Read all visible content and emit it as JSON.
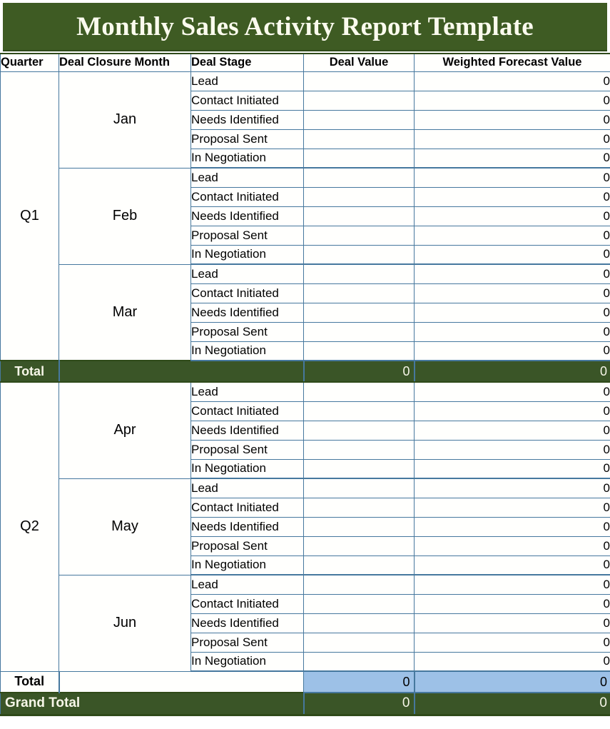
{
  "title": "Monthly Sales Activity Report Template",
  "colors": {
    "banner_green": "#3E5B23",
    "total_green": "#3A5527",
    "selection_blue": "#9DC1E7",
    "grid_border": "#46789E",
    "cell_background": "#FFFFFD",
    "banner_text": "#FBFBEE"
  },
  "columns": [
    {
      "key": "quarter",
      "label": "Quarter"
    },
    {
      "key": "month",
      "label": "Deal Closure Month"
    },
    {
      "key": "stage",
      "label": "Deal Stage"
    },
    {
      "key": "value",
      "label": "Deal Value"
    },
    {
      "key": "wfv",
      "label": "Weighted Forecast Value"
    }
  ],
  "stages": [
    "Lead",
    "Contact Initiated",
    "Needs Identified",
    "Proposal Sent",
    "In Negotiation"
  ],
  "quarters": [
    {
      "label": "Q1",
      "months": [
        {
          "name": "Jan",
          "rows": [
            {
              "stage": "Lead",
              "value": "",
              "wfv": "0"
            },
            {
              "stage": "Contact Initiated",
              "value": "",
              "wfv": "0"
            },
            {
              "stage": "Needs Identified",
              "value": "",
              "wfv": "0"
            },
            {
              "stage": "Proposal Sent",
              "value": "",
              "wfv": "0"
            },
            {
              "stage": "In Negotiation",
              "value": "",
              "wfv": "0"
            }
          ]
        },
        {
          "name": "Feb",
          "rows": [
            {
              "stage": "Lead",
              "value": "",
              "wfv": "0"
            },
            {
              "stage": "Contact Initiated",
              "value": "",
              "wfv": "0"
            },
            {
              "stage": "Needs Identified",
              "value": "",
              "wfv": "0"
            },
            {
              "stage": "Proposal Sent",
              "value": "",
              "wfv": "0"
            },
            {
              "stage": "In Negotiation",
              "value": "",
              "wfv": "0"
            }
          ]
        },
        {
          "name": "Mar",
          "rows": [
            {
              "stage": "Lead",
              "value": "",
              "wfv": "0"
            },
            {
              "stage": "Contact Initiated",
              "value": "",
              "wfv": "0"
            },
            {
              "stage": "Needs Identified",
              "value": "",
              "wfv": "0"
            },
            {
              "stage": "Proposal Sent",
              "value": "",
              "wfv": "0"
            },
            {
              "stage": "In Negotiation",
              "value": "",
              "wfv": "0"
            }
          ]
        }
      ],
      "total": {
        "label": "Total",
        "value": "0",
        "wfv": "0",
        "style": "green"
      }
    },
    {
      "label": "Q2",
      "months": [
        {
          "name": "Apr",
          "rows": [
            {
              "stage": "Lead",
              "value": "",
              "wfv": "0"
            },
            {
              "stage": "Contact Initiated",
              "value": "",
              "wfv": "0"
            },
            {
              "stage": "Needs Identified",
              "value": "",
              "wfv": "0"
            },
            {
              "stage": "Proposal Sent",
              "value": "",
              "wfv": "0"
            },
            {
              "stage": "In Negotiation",
              "value": "",
              "wfv": "0"
            }
          ]
        },
        {
          "name": "May",
          "rows": [
            {
              "stage": "Lead",
              "value": "",
              "wfv": "0"
            },
            {
              "stage": "Contact Initiated",
              "value": "",
              "wfv": "0"
            },
            {
              "stage": "Needs Identified",
              "value": "",
              "wfv": "0"
            },
            {
              "stage": "Proposal Sent",
              "value": "",
              "wfv": "0"
            },
            {
              "stage": "In Negotiation",
              "value": "",
              "wfv": "0"
            }
          ]
        },
        {
          "name": "Jun",
          "rows": [
            {
              "stage": "Lead",
              "value": "",
              "wfv": "0"
            },
            {
              "stage": "Contact Initiated",
              "value": "",
              "wfv": "0"
            },
            {
              "stage": "Needs Identified",
              "value": "",
              "wfv": "0"
            },
            {
              "stage": "Proposal Sent",
              "value": "",
              "wfv": "0"
            },
            {
              "stage": "In Negotiation",
              "value": "",
              "wfv": "0"
            }
          ]
        }
      ],
      "total": {
        "label": "Total",
        "value": "0",
        "wfv": "0",
        "style": "selected"
      }
    }
  ],
  "grand_total": {
    "label": "Grand Total",
    "value": "0",
    "wfv": "0"
  }
}
